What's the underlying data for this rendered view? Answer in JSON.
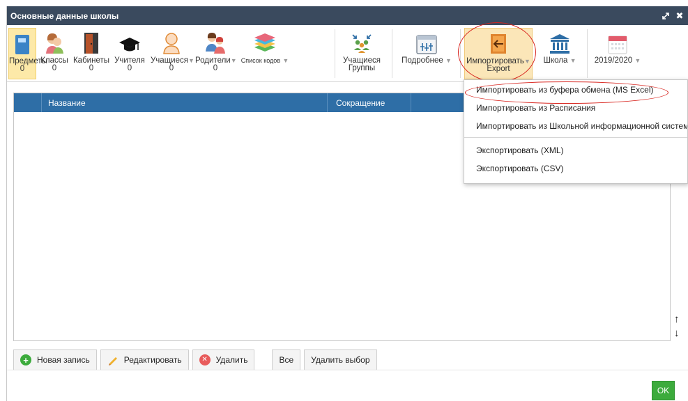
{
  "window": {
    "title": "Основные данные школы"
  },
  "toolbar": {
    "subjects": {
      "label": "Предметы",
      "count": "0"
    },
    "classes": {
      "label": "Классы",
      "count": "0"
    },
    "rooms": {
      "label": "Кабинеты",
      "count": "0"
    },
    "teachers": {
      "label": "Учителя",
      "count": "0"
    },
    "students": {
      "label": "Учащиеся",
      "count": "0"
    },
    "parents": {
      "label": "Родители",
      "count": "0"
    },
    "codes": {
      "label": "Список кодов"
    },
    "groups": {
      "label1": "Учащиеся",
      "label2": "Группы"
    },
    "details": {
      "label": "Подробнее"
    },
    "import": {
      "label1": "Импортировать",
      "label2": "Export"
    },
    "school": {
      "label": "Школа"
    },
    "year": {
      "label": "2019/2020"
    }
  },
  "grid": {
    "col_name": "Название",
    "col_short": "Сокращение"
  },
  "bottom": {
    "new": "Новая запись",
    "edit": "Редактировать",
    "delete": "Удалить",
    "all": "Все",
    "delete_selection": "Удалить выбор"
  },
  "ok": "OK",
  "menu": {
    "items": [
      "Импортировать из буфера обмена (MS Excel)",
      "Импортировать из Расписания",
      "Импортировать из Школьной информационной системы",
      "Экспортировать (XML)",
      "Экспортировать (CSV)"
    ]
  },
  "colors": {
    "header": "#3a4a5e",
    "grid_header": "#2e6ea6",
    "ok": "#3cab3c",
    "highlight": "#d8251f"
  }
}
